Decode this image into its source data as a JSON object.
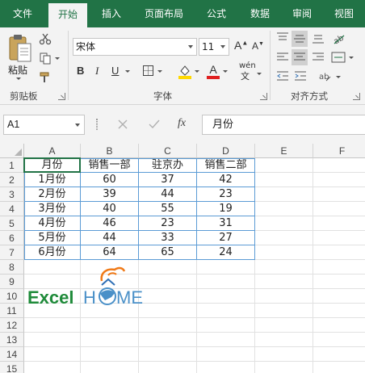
{
  "menu": {
    "tabs": [
      {
        "label": "文件",
        "active": false
      },
      {
        "label": "开始",
        "active": true
      },
      {
        "label": "插入",
        "active": false
      },
      {
        "label": "页面布局",
        "active": false
      },
      {
        "label": "公式",
        "active": false
      },
      {
        "label": "数据",
        "active": false
      },
      {
        "label": "审阅",
        "active": false
      },
      {
        "label": "视图",
        "active": false
      }
    ]
  },
  "ribbon": {
    "clipboard": {
      "paste_label": "粘贴",
      "group_label": "剪贴板"
    },
    "font": {
      "font_name": "宋体",
      "font_size": "11",
      "group_label": "字体",
      "phonetic_label": "wén"
    },
    "alignment": {
      "group_label": "对齐方式"
    },
    "colors": {
      "fill": "#ffd800",
      "font": "#e02020",
      "accent": "#217346"
    }
  },
  "formula_bar": {
    "name_box": "A1",
    "formula_value": "月份",
    "fx_label": "fx"
  },
  "sheet": {
    "columns": [
      "A",
      "B",
      "C",
      "D",
      "E",
      "F"
    ],
    "rows": [
      "1",
      "2",
      "3",
      "4",
      "5",
      "6",
      "7",
      "8",
      "9",
      "10",
      "11",
      "12",
      "13",
      "14",
      "15"
    ],
    "table": {
      "headers": [
        "月份",
        "销售一部",
        "驻京办",
        "销售二部"
      ],
      "rows": [
        [
          "1月份",
          "60",
          "37",
          "42"
        ],
        [
          "2月份",
          "39",
          "44",
          "23"
        ],
        [
          "3月份",
          "40",
          "55",
          "19"
        ],
        [
          "4月份",
          "46",
          "23",
          "31"
        ],
        [
          "5月份",
          "44",
          "33",
          "27"
        ],
        [
          "6月份",
          "64",
          "65",
          "24"
        ]
      ]
    },
    "logo": {
      "part1": "Excel",
      "part2": "H",
      "part3": "ME"
    }
  }
}
